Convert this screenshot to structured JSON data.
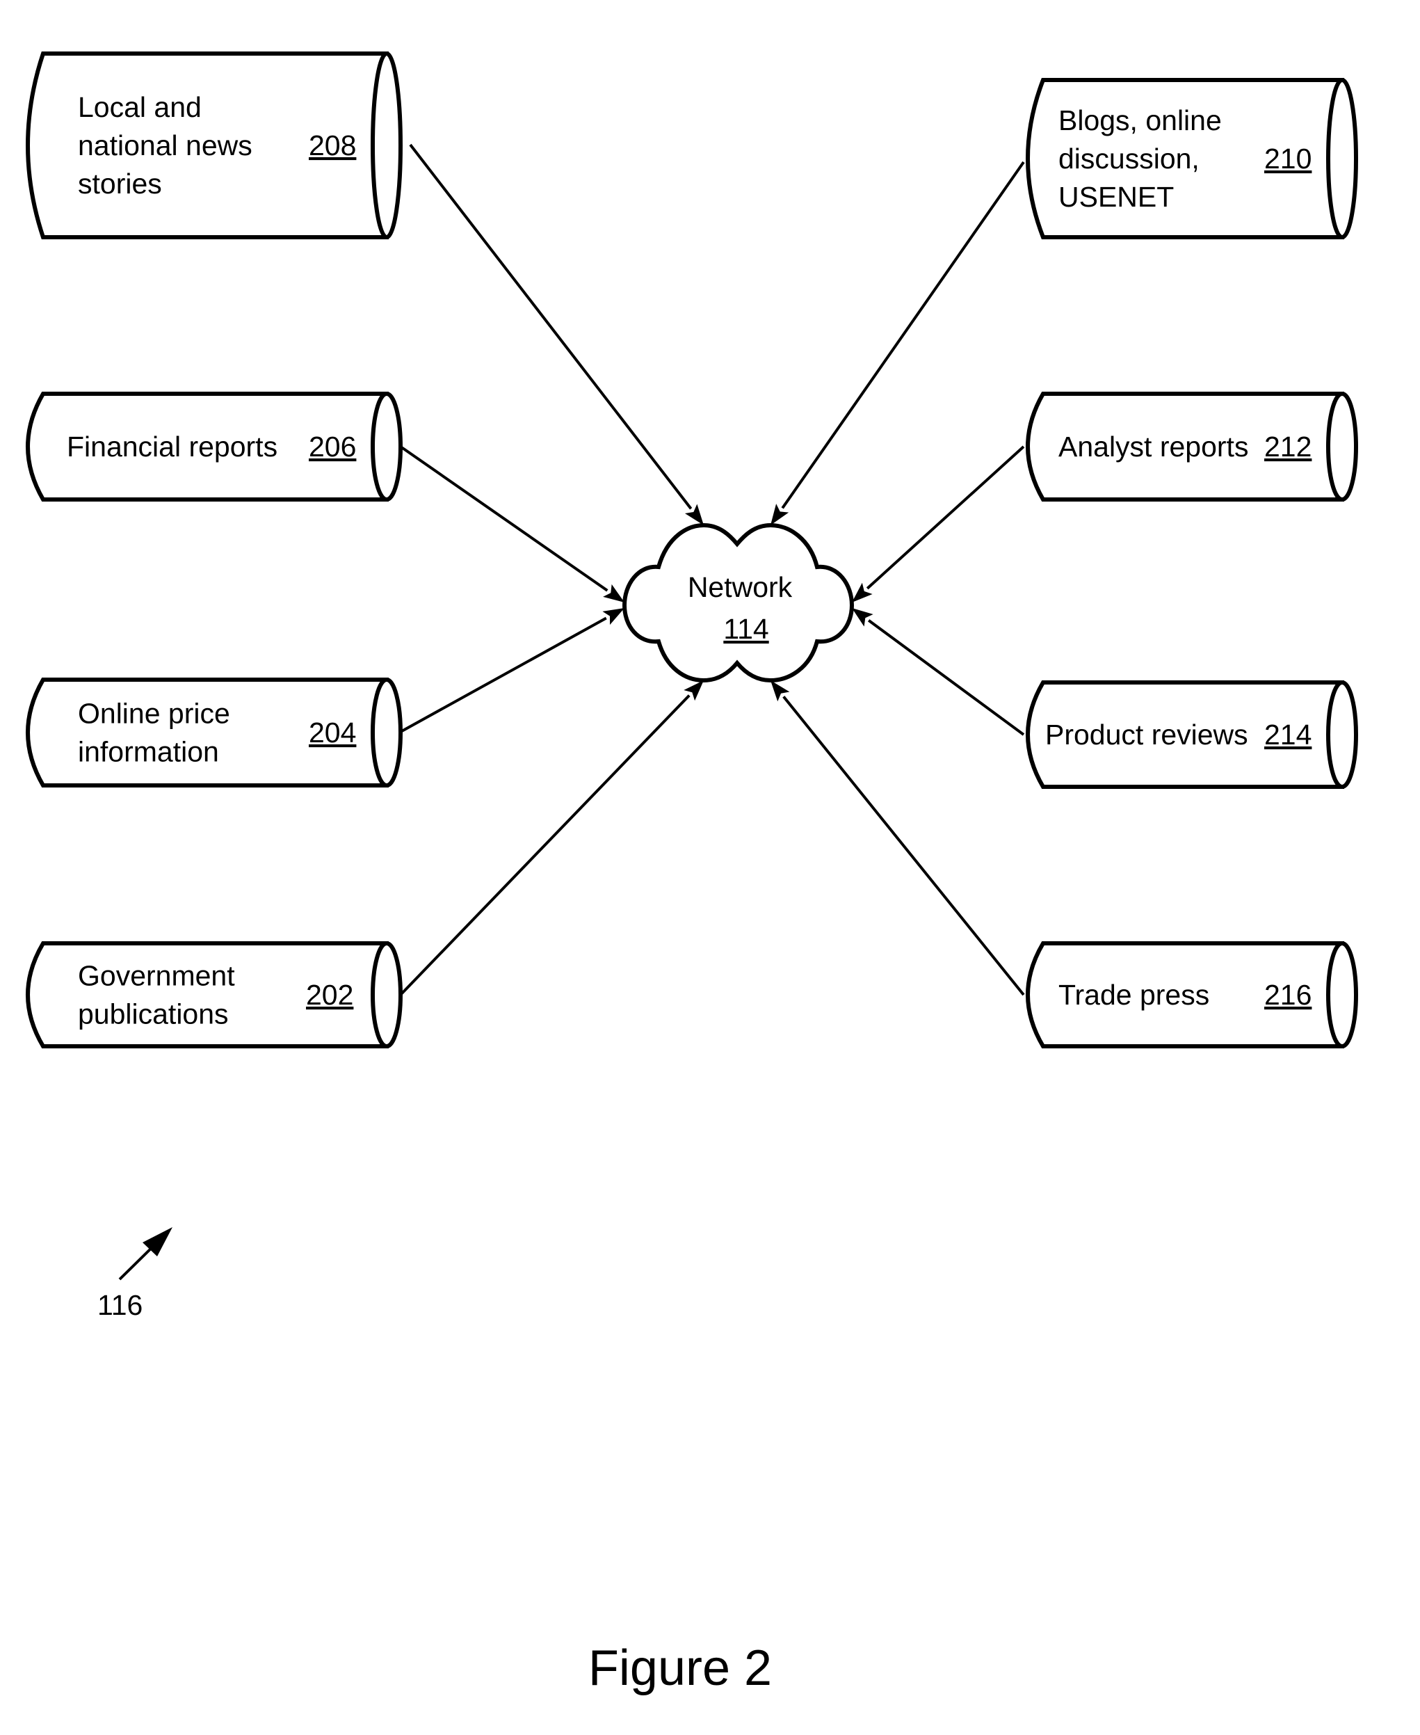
{
  "figure": {
    "caption": "Figure 2",
    "diagram_ref": "116"
  },
  "network": {
    "label": "Network",
    "ref": "114"
  },
  "sources_left": [
    {
      "id": "208",
      "lines": [
        "Local and",
        "national news",
        "stories"
      ],
      "ref": "208"
    },
    {
      "id": "206",
      "lines": [
        "Financial reports"
      ],
      "ref": "206"
    },
    {
      "id": "204",
      "lines": [
        "Online price",
        "information"
      ],
      "ref": "204"
    },
    {
      "id": "202",
      "lines": [
        "Government",
        "publications"
      ],
      "ref": "202"
    }
  ],
  "sources_right": [
    {
      "id": "210",
      "lines": [
        "Blogs, online",
        "discussion,",
        "USENET"
      ],
      "ref": "210"
    },
    {
      "id": "212",
      "lines": [
        "Analyst reports"
      ],
      "ref": "212"
    },
    {
      "id": "214",
      "lines": [
        "Product reviews"
      ],
      "ref": "214"
    },
    {
      "id": "216",
      "lines": [
        "Trade press"
      ],
      "ref": "216"
    }
  ],
  "edges": [
    {
      "from": "208",
      "to": "114"
    },
    {
      "from": "206",
      "to": "114"
    },
    {
      "from": "204",
      "to": "114"
    },
    {
      "from": "202",
      "to": "114"
    },
    {
      "from": "210",
      "to": "114"
    },
    {
      "from": "212",
      "to": "114"
    },
    {
      "from": "214",
      "to": "114"
    },
    {
      "from": "216",
      "to": "114"
    }
  ]
}
